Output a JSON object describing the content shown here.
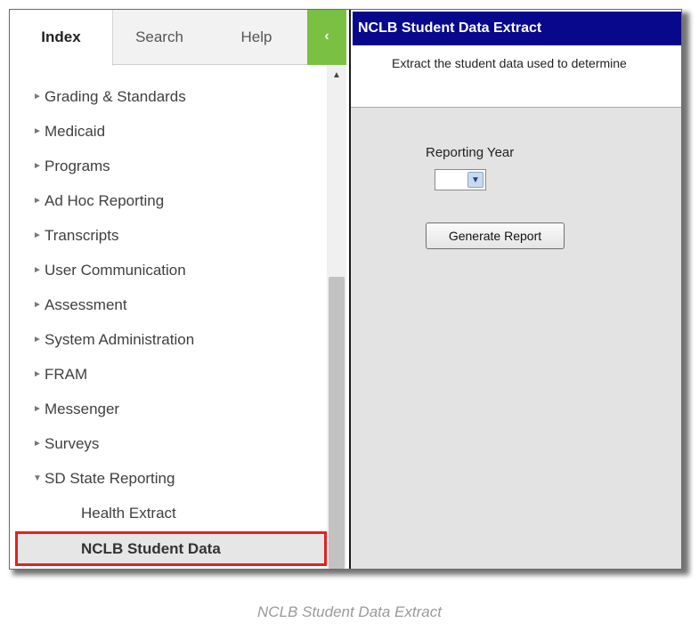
{
  "tabs": [
    {
      "label": "Index",
      "active": true
    },
    {
      "label": "Search",
      "active": false
    },
    {
      "label": "Help",
      "active": false
    }
  ],
  "collapse_icon": "chevron-left-icon",
  "collapse_glyph": "‹",
  "nav_items": [
    {
      "label": "Grading & Standards",
      "expanded": false
    },
    {
      "label": "Medicaid",
      "expanded": false
    },
    {
      "label": "Programs",
      "expanded": false
    },
    {
      "label": "Ad Hoc Reporting",
      "expanded": false
    },
    {
      "label": "Transcripts",
      "expanded": false
    },
    {
      "label": "User Communication",
      "expanded": false
    },
    {
      "label": "Assessment",
      "expanded": false
    },
    {
      "label": "System Administration",
      "expanded": false
    },
    {
      "label": "FRAM",
      "expanded": false
    },
    {
      "label": "Messenger",
      "expanded": false
    },
    {
      "label": "Surveys",
      "expanded": false
    },
    {
      "label": "SD State Reporting",
      "expanded": true
    }
  ],
  "sub_items": [
    {
      "label": "Health Extract",
      "selected": false
    },
    {
      "label": "NCLB Student Data",
      "selected": true
    }
  ],
  "content": {
    "title": "NCLB Student Data Extract",
    "description": "Extract the student data used to determine",
    "reporting_year_label": "Reporting Year",
    "reporting_year_value": "",
    "generate_button": "Generate Report"
  },
  "caption": "NCLB Student Data Extract",
  "colors": {
    "title_bar": "#08088c",
    "collapse_button": "#7ac143",
    "selected_outline": "#e1221f"
  }
}
